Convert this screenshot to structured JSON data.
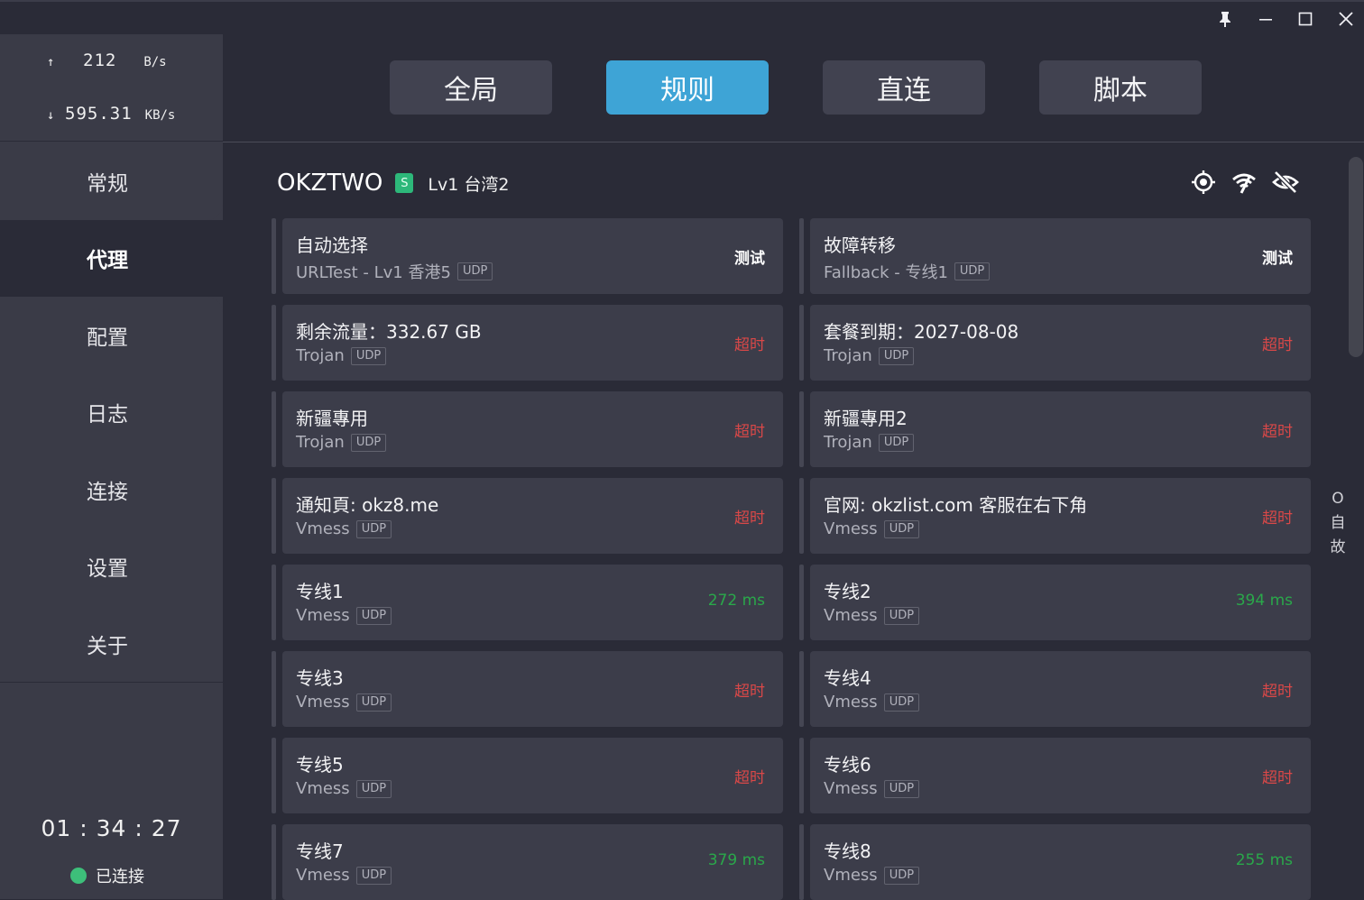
{
  "window": {
    "pin_icon": "pin-icon",
    "minimize_icon": "minimize-icon",
    "maximize_icon": "maximize-icon",
    "close_icon": "close-icon"
  },
  "traffic": {
    "up_arrow": "↑",
    "up_value": "212",
    "up_unit": "B/s",
    "down_arrow": "↓",
    "down_value": "595.31",
    "down_unit": "KB/s"
  },
  "nav": {
    "items": [
      {
        "label": "常规"
      },
      {
        "label": "代理"
      },
      {
        "label": "配置"
      },
      {
        "label": "日志"
      },
      {
        "label": "连接"
      },
      {
        "label": "设置"
      },
      {
        "label": "关于"
      }
    ],
    "active": "代理"
  },
  "footer": {
    "timer": "01 : 34 : 27",
    "status": "已连接",
    "status_color": "#3dbf7a"
  },
  "modes": {
    "items": [
      {
        "label": "全局"
      },
      {
        "label": "规则"
      },
      {
        "label": "直连"
      },
      {
        "label": "脚本"
      }
    ],
    "active": "规则",
    "active_color": "#3ea4d6"
  },
  "group": {
    "name": "OKZTWO",
    "badge": "S",
    "current": "Lv1 台湾2",
    "icons": [
      "locate-icon",
      "wifi-test-icon",
      "eye-off-icon"
    ]
  },
  "proxies": [
    {
      "name": "自动选择",
      "type": "URLTest - Lv1 香港5",
      "udp": "UDP",
      "latency": "测试",
      "state": "test"
    },
    {
      "name": "故障转移",
      "type": "Fallback - 专线1",
      "udp": "UDP",
      "latency": "测试",
      "state": "test"
    },
    {
      "name": "剩余流量：332.67 GB",
      "type": "Trojan",
      "udp": "UDP",
      "latency": "超时",
      "state": "timeout"
    },
    {
      "name": "套餐到期：2027-08-08",
      "type": "Trojan",
      "udp": "UDP",
      "latency": "超时",
      "state": "timeout"
    },
    {
      "name": "新疆專用",
      "type": "Trojan",
      "udp": "UDP",
      "latency": "超时",
      "state": "timeout"
    },
    {
      "name": "新疆專用2",
      "type": "Trojan",
      "udp": "UDP",
      "latency": "超时",
      "state": "timeout"
    },
    {
      "name": "通知頁: okz8.me",
      "type": "Vmess",
      "udp": "UDP",
      "latency": "超时",
      "state": "timeout"
    },
    {
      "name": "官网: okzlist.com 客服在右下角",
      "type": "Vmess",
      "udp": "UDP",
      "latency": "超时",
      "state": "timeout"
    },
    {
      "name": "专线1",
      "type": "Vmess",
      "udp": "UDP",
      "latency": "272 ms",
      "state": "ok"
    },
    {
      "name": "专线2",
      "type": "Vmess",
      "udp": "UDP",
      "latency": "394 ms",
      "state": "ok"
    },
    {
      "name": "专线3",
      "type": "Vmess",
      "udp": "UDP",
      "latency": "超时",
      "state": "timeout"
    },
    {
      "name": "专线4",
      "type": "Vmess",
      "udp": "UDP",
      "latency": "超时",
      "state": "timeout"
    },
    {
      "name": "专线5",
      "type": "Vmess",
      "udp": "UDP",
      "latency": "超时",
      "state": "timeout"
    },
    {
      "name": "专线6",
      "type": "Vmess",
      "udp": "UDP",
      "latency": "超时",
      "state": "timeout"
    },
    {
      "name": "专线7",
      "type": "Vmess",
      "udp": "UDP",
      "latency": "379 ms",
      "state": "ok"
    },
    {
      "name": "专线8",
      "type": "Vmess",
      "udp": "UDP",
      "latency": "255 ms",
      "state": "ok"
    }
  ],
  "side_hint": {
    "lines": [
      "O",
      "自",
      "故"
    ]
  }
}
